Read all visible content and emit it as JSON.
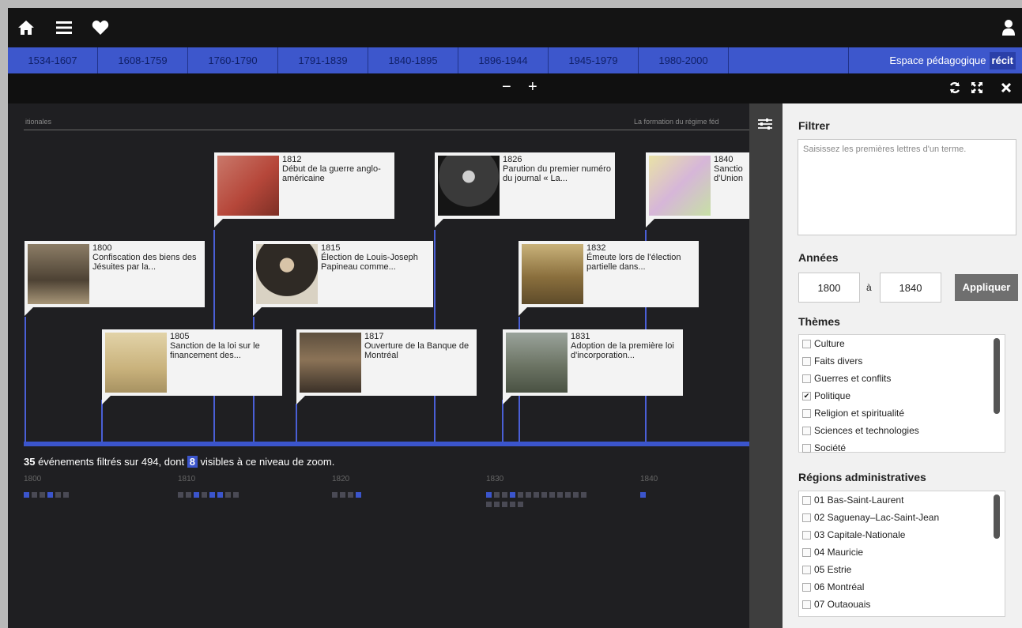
{
  "toolbar": {
    "icons": [
      "home-icon",
      "menu-icon",
      "heart-icon",
      "user-icon"
    ]
  },
  "periods": [
    "1534-1607",
    "1608-1759",
    "1760-1790",
    "1791-1839",
    "1840-1895",
    "1896-1944",
    "1945-1979",
    "1980-2000",
    ""
  ],
  "espace": {
    "label": "Espace pédagogique",
    "brand": "récit"
  },
  "zoom": {
    "minus": "−",
    "plus": "+"
  },
  "window_icons": [
    "refresh-icon",
    "fullscreen-icon",
    "close-icon"
  ],
  "timeline": {
    "left_band": "itionales",
    "right_band": "La formation du régime féd",
    "events": [
      {
        "year": "1812",
        "title": "Début de la guerre anglo-américaine"
      },
      {
        "year": "1826",
        "title": "Parution du premier numéro du journal « La..."
      },
      {
        "year": "1840",
        "title": "Sanctio d'Union"
      },
      {
        "year": "1800",
        "title": "Confiscation des biens des Jésuites par la..."
      },
      {
        "year": "1815",
        "title": "Élection de Louis-Joseph Papineau comme..."
      },
      {
        "year": "1832",
        "title": "Émeute lors de l'élection partielle dans..."
      },
      {
        "year": "1805",
        "title": "Sanction de la loi sur le financement des..."
      },
      {
        "year": "1817",
        "title": "Ouverture de la Banque de Montréal"
      },
      {
        "year": "1831",
        "title": "Adoption de la première loi d'incorporation..."
      }
    ],
    "count": {
      "filtered": "35",
      "text_a": " événements filtrés sur 494, dont ",
      "visible": "8",
      "text_b": " visibles à ce niveau de zoom."
    },
    "ticks": [
      "1800",
      "1810",
      "1820",
      "1830",
      "1840"
    ]
  },
  "colors": {
    "accent": "#3b55cc",
    "dark": "#1f1f22",
    "card": "#f3f3f3"
  },
  "panel": {
    "filter_title": "Filtrer",
    "filter_placeholder": "Saisissez les premières lettres d'un terme.",
    "years_title": "Années",
    "year_from": "1800",
    "year_sep": "à",
    "year_to": "1840",
    "apply": "Appliquer",
    "themes_title": "Thèmes",
    "themes": [
      {
        "label": "Culture",
        "checked": false
      },
      {
        "label": "Faits divers",
        "checked": false
      },
      {
        "label": "Guerres et conflits",
        "checked": false
      },
      {
        "label": "Politique",
        "checked": true
      },
      {
        "label": "Religion et spiritualité",
        "checked": false
      },
      {
        "label": "Sciences et technologies",
        "checked": false
      },
      {
        "label": "Société",
        "checked": false
      }
    ],
    "regions_title": "Régions administratives",
    "regions": [
      {
        "label": "01 Bas-Saint-Laurent",
        "checked": false
      },
      {
        "label": "02 Saguenay–Lac-Saint-Jean",
        "checked": false
      },
      {
        "label": "03 Capitale-Nationale",
        "checked": false
      },
      {
        "label": "04 Mauricie",
        "checked": false
      },
      {
        "label": "05 Estrie",
        "checked": false
      },
      {
        "label": "06 Montréal",
        "checked": false
      },
      {
        "label": "07 Outaouais",
        "checked": false
      }
    ]
  }
}
